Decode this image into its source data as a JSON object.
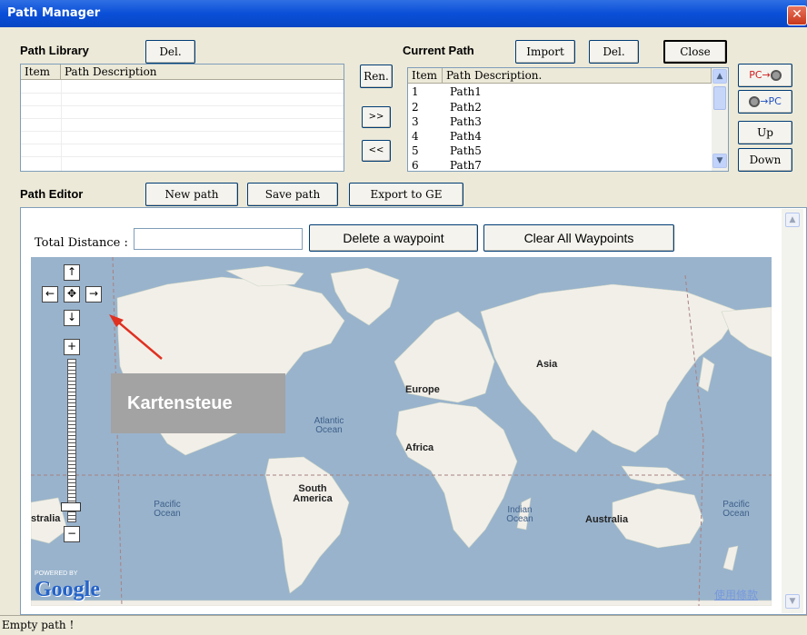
{
  "window": {
    "title": "Path Manager",
    "close_glyph": "✕"
  },
  "library": {
    "label": "Path Library",
    "del_label": "Del.",
    "columns": [
      "Item",
      "Path Description"
    ]
  },
  "transfer": {
    "rename_label": "Ren.",
    "to_current_label": ">>",
    "to_library_label": "<<"
  },
  "current": {
    "label": "Current Path",
    "import_label": "Import",
    "del_label": "Del.",
    "close_label": "Close",
    "columns": [
      "Item",
      "Path Description."
    ],
    "rows": [
      {
        "item": "1",
        "desc": "Path1"
      },
      {
        "item": "2",
        "desc": "Path2"
      },
      {
        "item": "3",
        "desc": "Path3"
      },
      {
        "item": "4",
        "desc": "Path4"
      },
      {
        "item": "5",
        "desc": "Path5"
      },
      {
        "item": "6",
        "desc": "Path7"
      }
    ]
  },
  "side": {
    "pc_to_device": "PC→",
    "device_to_pc": "→PC",
    "up_label": "Up",
    "down_label": "Down"
  },
  "editor": {
    "label": "Path Editor",
    "new_path_label": "New path",
    "save_path_label": "Save path",
    "export_label": "Export to GE",
    "total_distance_label": "Total Distance :",
    "total_distance_value": "",
    "delete_waypoint_label": "Delete a waypoint",
    "clear_waypoints_label": "Clear All Waypoints"
  },
  "map": {
    "labels": {
      "asia": "Asia",
      "europe": "Europe",
      "africa": "Africa",
      "south_america": "South America",
      "australia": "Australia",
      "australia_left": "stralia",
      "atlantic": "Atlantic Ocean",
      "pacific_left": "Pacific Ocean",
      "pacific_right": "Pacific Ocean",
      "indian": "Indian Ocean"
    },
    "annotation": "Kartensteue",
    "powered_by": "POWERED BY",
    "google": "Google",
    "terms": "使用條款",
    "colors": {
      "ocean": "#99b3cc",
      "land": "#f2efe9",
      "annotation_bg": "#a3a3a3",
      "arrow": "#e03020"
    }
  },
  "status": {
    "text": "Empty path !"
  }
}
